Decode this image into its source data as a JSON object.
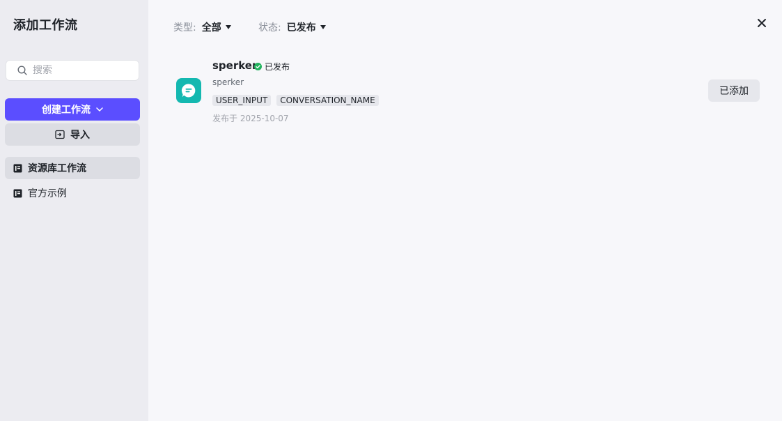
{
  "sidebar": {
    "title": "添加工作流",
    "search_placeholder": "搜索",
    "create_label": "创建工作流",
    "import_label": "导入",
    "nav": [
      {
        "label": "资源库工作流",
        "active": true
      },
      {
        "label": "官方示例",
        "active": false
      }
    ]
  },
  "filters": {
    "type_label": "类型:",
    "type_value": "全部",
    "status_label": "状态:",
    "status_value": "已发布"
  },
  "workflows": [
    {
      "name": "sperker",
      "status": "已发布",
      "description": "sperker",
      "tags": [
        "USER_INPUT",
        "CONVERSATION_NAME"
      ],
      "published": "发布于 2025-10-07",
      "action_label": "已添加"
    }
  ],
  "colors": {
    "accent": "#5b4eff",
    "icon_bg": "#14b8b0",
    "published_green": "#22b35e"
  },
  "icons": {
    "search": "search-icon",
    "chevron": "chevron-down-icon",
    "import": "import-icon",
    "library": "library-icon",
    "close": "close-icon",
    "chat": "chat-bubble-icon",
    "check": "check-circle-icon"
  }
}
